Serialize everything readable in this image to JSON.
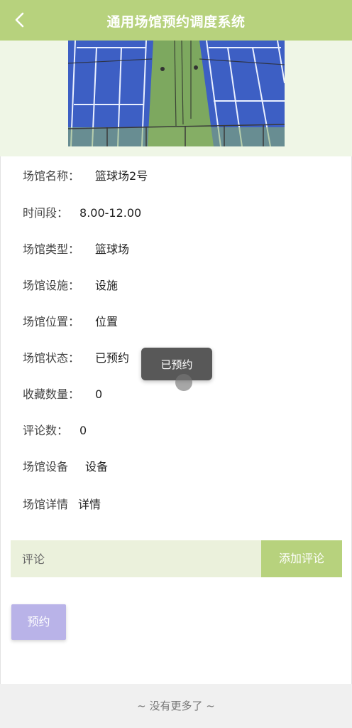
{
  "header": {
    "title": "通用场馆预约调度系统",
    "back_icon": "chevron-left-icon",
    "color": "#b7d27d"
  },
  "banner": {
    "image": "tennis-court-photo",
    "background": "#eff6e6"
  },
  "details": [
    {
      "label": "场馆名称：",
      "value": "篮球场2号"
    },
    {
      "label": "时间段：",
      "value": "8.00-12.00"
    },
    {
      "label": "场馆类型：",
      "value": "篮球场"
    },
    {
      "label": "场馆设施：",
      "value": "设施"
    },
    {
      "label": "场馆位置：",
      "value": "位置"
    },
    {
      "label": "场馆状态：",
      "value": "已预约"
    },
    {
      "label": "收藏数量：",
      "value": "0"
    },
    {
      "label": "评论数：",
      "value": "0"
    },
    {
      "label": "场馆设备",
      "value": "设备"
    },
    {
      "label": "场馆详情",
      "value": "详情"
    }
  ],
  "comment": {
    "placeholder": "评论",
    "add_label": "添加评论"
  },
  "reserve": {
    "label": "预约",
    "color": "#b9b3e8"
  },
  "toast": {
    "text": "已预约"
  },
  "footer": {
    "text": "~ 没有更多了 ~"
  }
}
